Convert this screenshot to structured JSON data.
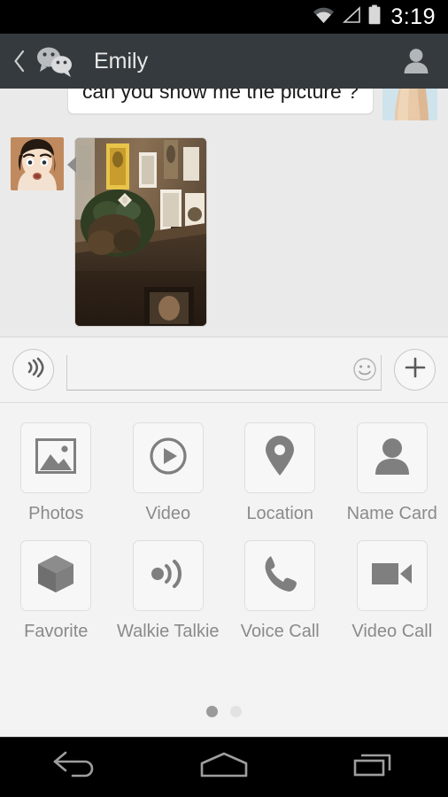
{
  "status_bar": {
    "time": "3:19",
    "icons": [
      "wifi-icon",
      "cellular-signal-icon",
      "battery-icon"
    ]
  },
  "header": {
    "back_label": "‹",
    "app_logo": "wechat-logo",
    "title": "Emily",
    "contact_icon": "person-icon",
    "background_color": "#353a3e"
  },
  "chat": {
    "background_color": "#eaeaea",
    "messages": [
      {
        "sender": "Emily",
        "direction": "incoming",
        "type": "text",
        "text": "can you show me the picture ?"
      },
      {
        "sender": "me",
        "direction": "outgoing",
        "type": "image",
        "text": ""
      }
    ]
  },
  "input_bar": {
    "voice_icon": "voice-wave-icon",
    "text_value": "",
    "placeholder": "",
    "emoji_icon": "smiley-face-icon",
    "plus_icon": "plus-icon"
  },
  "attachment_panel": {
    "background_color": "#f3f3f3",
    "items": [
      {
        "label": "Photos",
        "icon": "image-icon"
      },
      {
        "label": "Video",
        "icon": "play-circle-icon"
      },
      {
        "label": "Location",
        "icon": "map-pin-icon"
      },
      {
        "label": "Name Card",
        "icon": "person-icon"
      },
      {
        "label": "Favorite",
        "icon": "cube-icon"
      },
      {
        "label": "Walkie Talkie",
        "icon": "sound-wave-icon"
      },
      {
        "label": "Voice Call",
        "icon": "phone-icon"
      },
      {
        "label": "Video Call",
        "icon": "video-camera-icon"
      }
    ],
    "page_count": 2,
    "active_page": 1
  },
  "nav_bar": {
    "buttons": [
      {
        "name": "back",
        "icon": "back-arrow-icon"
      },
      {
        "name": "home",
        "icon": "home-icon"
      },
      {
        "name": "recents",
        "icon": "recents-icon"
      }
    ]
  }
}
